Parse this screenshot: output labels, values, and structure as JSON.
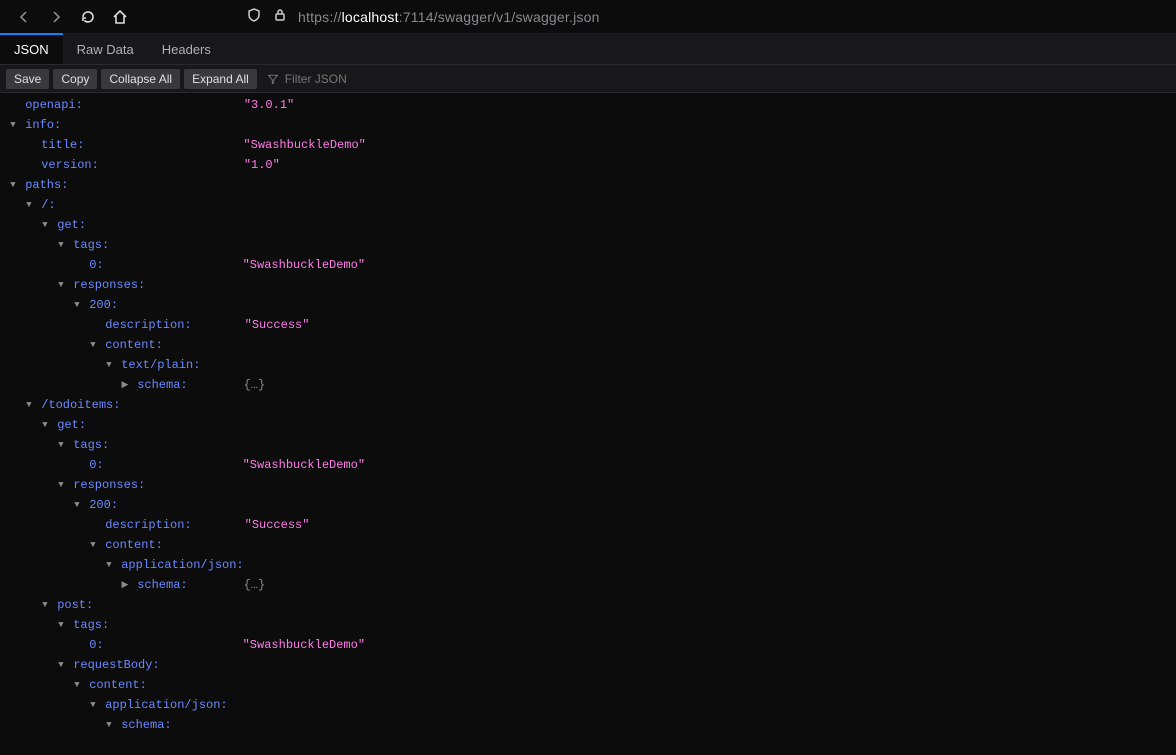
{
  "url": {
    "scheme": "https://",
    "host": "localhost",
    "rest": ":7114/swagger/v1/swagger.json"
  },
  "tabs": [
    "JSON",
    "Raw Data",
    "Headers"
  ],
  "activeTab": 0,
  "actions": {
    "save": "Save",
    "copy": "Copy",
    "collapseAll": "Collapse All",
    "expandAll": "Expand All",
    "filterPlaceholder": "Filter JSON"
  },
  "valueColumn": 239,
  "rows": [
    {
      "indent": 0,
      "twisty": "",
      "key": "openapi",
      "ktype": "key",
      "value": "\"3.0.1\"",
      "vtype": "str"
    },
    {
      "indent": 0,
      "twisty": "▼",
      "key": "info",
      "ktype": "key"
    },
    {
      "indent": 1,
      "twisty": "",
      "key": "title",
      "ktype": "key",
      "value": "\"SwashbuckleDemo\"",
      "vtype": "str"
    },
    {
      "indent": 1,
      "twisty": "",
      "key": "version",
      "ktype": "key",
      "value": "\"1.0\"",
      "vtype": "str"
    },
    {
      "indent": 0,
      "twisty": "▼",
      "key": "paths",
      "ktype": "key"
    },
    {
      "indent": 1,
      "twisty": "▼",
      "key": "/",
      "ktype": "key"
    },
    {
      "indent": 2,
      "twisty": "▼",
      "key": "get",
      "ktype": "key"
    },
    {
      "indent": 3,
      "twisty": "▼",
      "key": "tags",
      "ktype": "key"
    },
    {
      "indent": 4,
      "twisty": "",
      "key": "0",
      "ktype": "key",
      "value": "\"SwashbuckleDemo\"",
      "vtype": "str"
    },
    {
      "indent": 3,
      "twisty": "▼",
      "key": "responses",
      "ktype": "key"
    },
    {
      "indent": 4,
      "twisty": "▼",
      "key": "200",
      "ktype": "key"
    },
    {
      "indent": 5,
      "twisty": "",
      "key": "description",
      "ktype": "key",
      "value": "\"Success\"",
      "vtype": "str"
    },
    {
      "indent": 5,
      "twisty": "▼",
      "key": "content",
      "ktype": "key"
    },
    {
      "indent": 6,
      "twisty": "▼",
      "key": "text/plain",
      "ktype": "key"
    },
    {
      "indent": 7,
      "twisty": "▶",
      "key": "schema",
      "ktype": "key",
      "value": "{…}",
      "vtype": "placeholder"
    },
    {
      "indent": 1,
      "twisty": "▼",
      "key": "/todoitems",
      "ktype": "key"
    },
    {
      "indent": 2,
      "twisty": "▼",
      "key": "get",
      "ktype": "key"
    },
    {
      "indent": 3,
      "twisty": "▼",
      "key": "tags",
      "ktype": "key"
    },
    {
      "indent": 4,
      "twisty": "",
      "key": "0",
      "ktype": "key",
      "value": "\"SwashbuckleDemo\"",
      "vtype": "str"
    },
    {
      "indent": 3,
      "twisty": "▼",
      "key": "responses",
      "ktype": "key"
    },
    {
      "indent": 4,
      "twisty": "▼",
      "key": "200",
      "ktype": "key"
    },
    {
      "indent": 5,
      "twisty": "",
      "key": "description",
      "ktype": "key",
      "value": "\"Success\"",
      "vtype": "str"
    },
    {
      "indent": 5,
      "twisty": "▼",
      "key": "content",
      "ktype": "key"
    },
    {
      "indent": 6,
      "twisty": "▼",
      "key": "application/json",
      "ktype": "key"
    },
    {
      "indent": 7,
      "twisty": "▶",
      "key": "schema",
      "ktype": "key",
      "value": "{…}",
      "vtype": "placeholder"
    },
    {
      "indent": 2,
      "twisty": "▼",
      "key": "post",
      "ktype": "key"
    },
    {
      "indent": 3,
      "twisty": "▼",
      "key": "tags",
      "ktype": "key"
    },
    {
      "indent": 4,
      "twisty": "",
      "key": "0",
      "ktype": "key",
      "value": "\"SwashbuckleDemo\"",
      "vtype": "str"
    },
    {
      "indent": 3,
      "twisty": "▼",
      "key": "requestBody",
      "ktype": "key"
    },
    {
      "indent": 4,
      "twisty": "▼",
      "key": "content",
      "ktype": "key"
    },
    {
      "indent": 5,
      "twisty": "▼",
      "key": "application/json",
      "ktype": "key"
    },
    {
      "indent": 6,
      "twisty": "▼",
      "key": "schema",
      "ktype": "key"
    }
  ]
}
